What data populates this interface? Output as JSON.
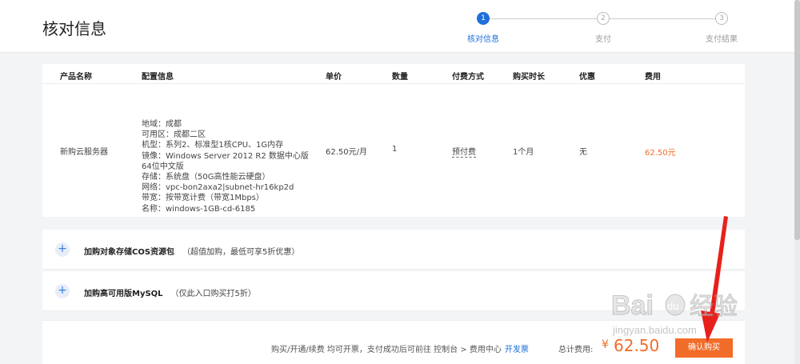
{
  "header": {
    "title": "核对信息",
    "steps": [
      {
        "num": "1",
        "label": "核对信息",
        "state": "active"
      },
      {
        "num": "2",
        "label": "支付",
        "state": "todo"
      },
      {
        "num": "3",
        "label": "支付结果",
        "state": "todo"
      }
    ]
  },
  "table": {
    "headers": [
      "产品名称",
      "配置信息",
      "单价",
      "数量",
      "付费方式",
      "购买时长",
      "优惠",
      "费用"
    ],
    "row": {
      "product": "新购云服务器",
      "config": [
        "地域：成都",
        "可用区：成都二区",
        "机型：系列2、标准型1核CPU、1G内存",
        "镜像：Windows Server 2012 R2 数据中心版",
        "64位中文版",
        "存储：系统盘（50G高性能云硬盘）",
        "网络：vpc-bon2axa2|subnet-hr16kp2d",
        "带宽：按带宽计费（带宽1Mbps）",
        "名称：windows-1GB-cd-6185"
      ],
      "unit_price": "62.50元/月",
      "quantity": "1",
      "payment": "预付费",
      "duration": "1个月",
      "discount": "无",
      "cost": "62.50元"
    }
  },
  "addons": [
    {
      "title": "加购对象存储COS资源包",
      "note": "（超值加购，最低可享5折优惠）"
    },
    {
      "title": "加购高可用版MySQL",
      "note": "（仅此入口购买打5折）"
    }
  ],
  "footer": {
    "note": "购买/开通/续费 均可开票，支付成功后可前往 控制台 > 费用中心",
    "link": "开发票",
    "total_label": "总计费用:",
    "currency": "¥",
    "total": "62.50",
    "confirm_label": "确认购买"
  },
  "watermark": {
    "logo": "Bai du 经验",
    "url": "jingyan.baidu.com"
  },
  "colors": {
    "accent": "#1e6fd9",
    "price": "#f26c2a",
    "annotation": "#e8201c"
  }
}
